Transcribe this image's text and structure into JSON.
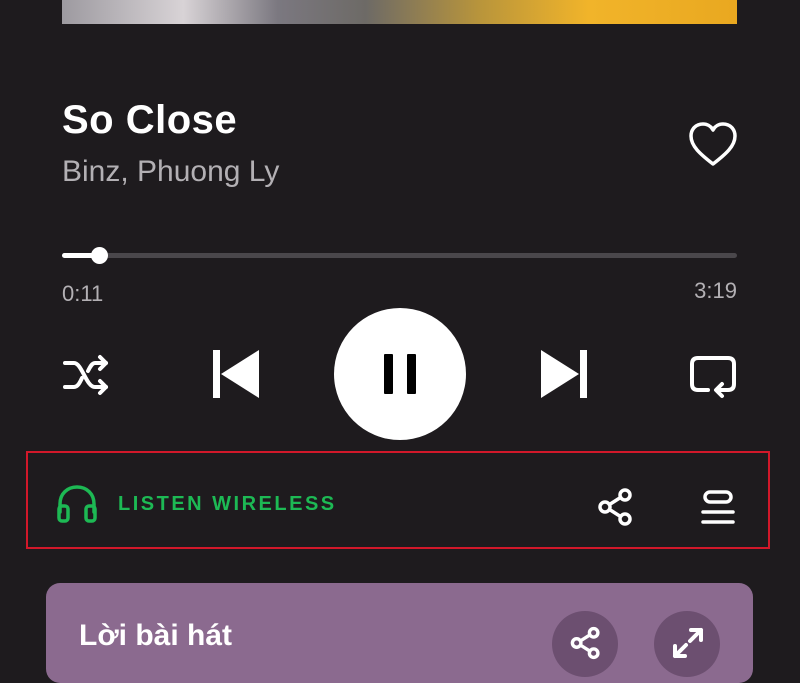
{
  "track": {
    "title": "So Close",
    "artist": "Binz, Phuong Ly"
  },
  "playback": {
    "elapsed": "0:11",
    "total": "3:19",
    "progress_fraction": 0.055
  },
  "device": {
    "label": "LISTEN WIRELESS",
    "accent_color": "#1db954"
  },
  "lyrics": {
    "title": "Lời bài hát"
  },
  "icons": {
    "heart": "heart-icon",
    "shuffle": "shuffle-icon",
    "previous": "skip-previous-icon",
    "pause": "pause-icon",
    "next": "skip-next-icon",
    "repeat": "repeat-icon",
    "headphones": "headphones-icon",
    "share": "share-icon",
    "queue": "queue-icon",
    "expand": "expand-icon"
  }
}
